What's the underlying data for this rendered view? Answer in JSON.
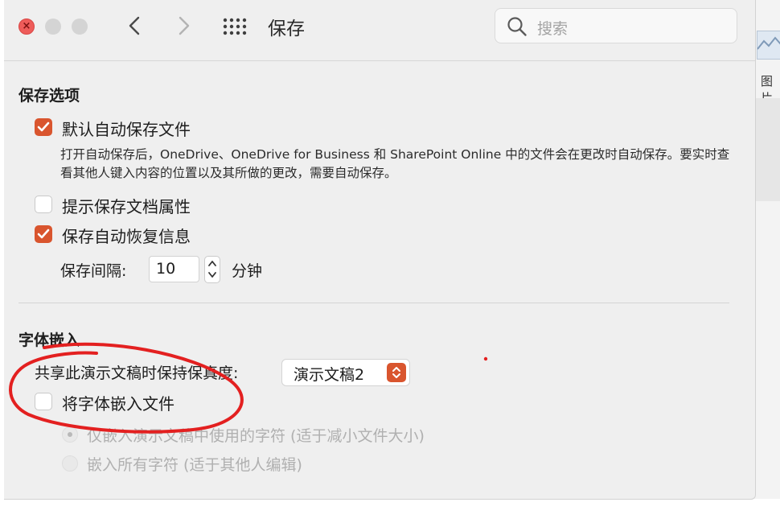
{
  "window": {
    "title": "保存",
    "search_placeholder": "搜索",
    "accent": "#d9552e"
  },
  "background_doc": {
    "text": "图片"
  },
  "save_options": {
    "heading": "保存选项",
    "autosave": {
      "label": "默认自动保存文件",
      "checked": true,
      "description": "打开自动保存后，OneDrive、OneDrive for Business 和 SharePoint Online 中的文件会在更改时自动保存。要实时查看其他人键入内容的位置以及其所做的更改，需要自动保存。"
    },
    "prompt_props": {
      "label": "提示保存文档属性",
      "checked": false
    },
    "autorecover": {
      "label": "保存自动恢复信息",
      "checked": true
    },
    "interval": {
      "label": "保存间隔:",
      "value": "10",
      "unit": "分钟"
    }
  },
  "font_embedding": {
    "heading": "字体嵌入",
    "fidelity_label": "共享此演示文稿时保持保真度:",
    "fidelity_value": "演示文稿2",
    "embed": {
      "label": "将字体嵌入文件",
      "checked": false
    },
    "options": [
      {
        "label": "仅嵌入演示文稿中使用的字符 (适于减小文件大小)",
        "selected": true
      },
      {
        "label": "嵌入所有字符 (适于其他人编辑)",
        "selected": false
      }
    ]
  },
  "annotation_color": "#e32020"
}
